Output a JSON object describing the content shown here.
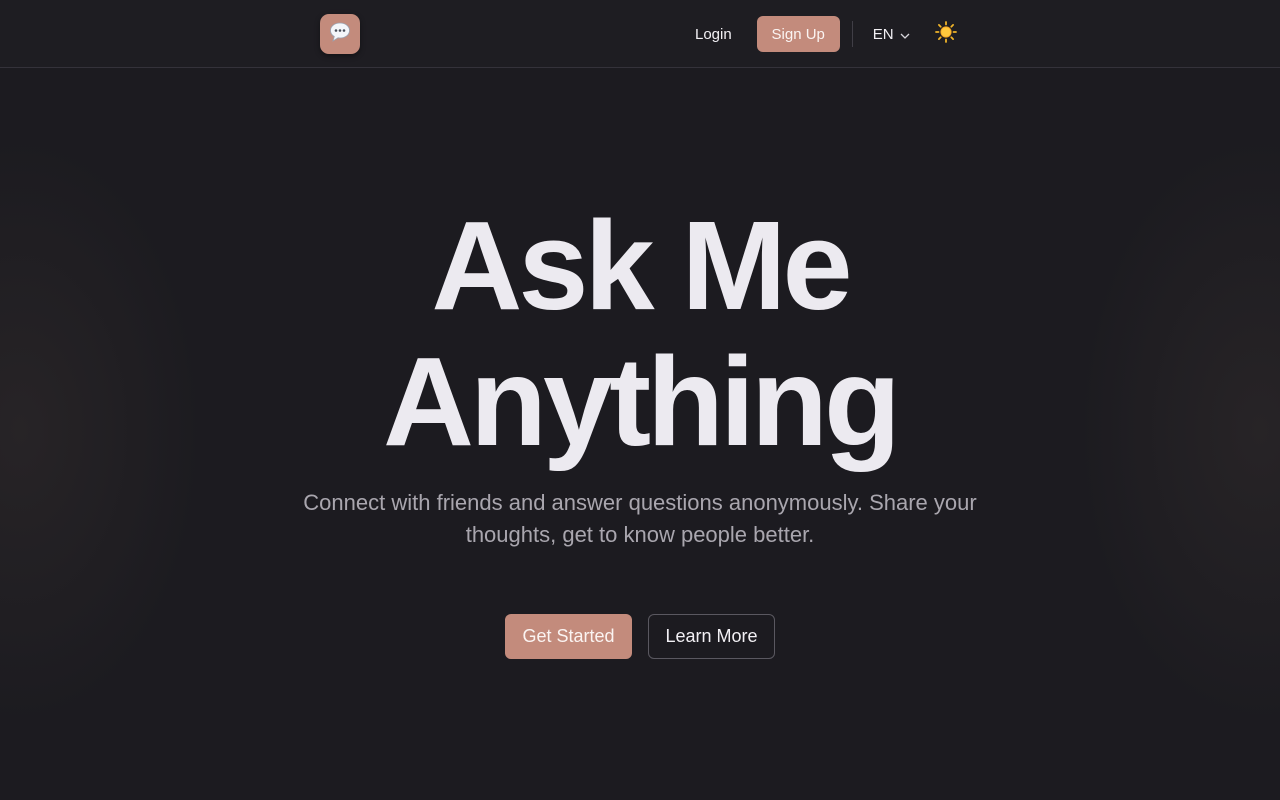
{
  "nav": {
    "logo_icon": "speech-bubble-icon",
    "login_label": "Login",
    "signup_label": "Sign Up",
    "language": "EN",
    "theme_icon": "sun-icon"
  },
  "hero": {
    "title_line1": "Ask Me",
    "title_line2": "Anything",
    "subtitle": "Connect with friends and answer questions anonymously. Share your thoughts, get to know people better.",
    "primary_cta": "Get Started",
    "secondary_cta": "Learn More"
  },
  "colors": {
    "background": "#1c1b20",
    "accent": "#c38b7c",
    "text": "#eceaf0",
    "muted_text": "#a9a6ae"
  }
}
